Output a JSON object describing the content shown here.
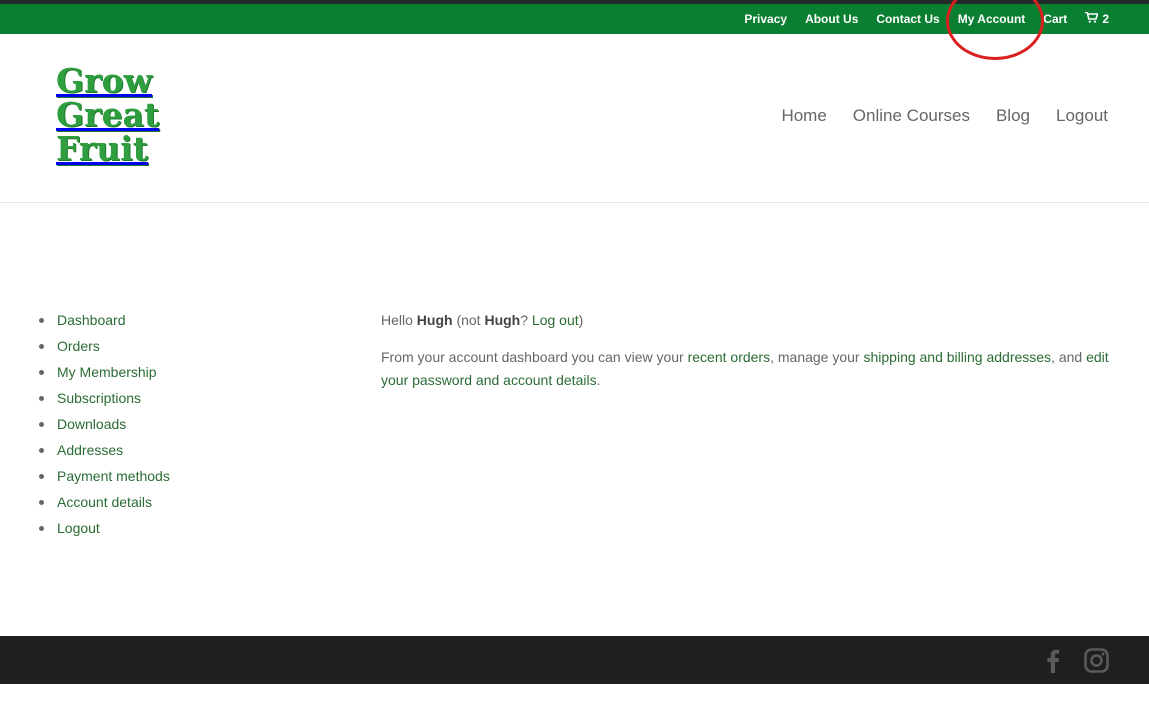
{
  "topbar": {
    "links": [
      "Privacy",
      "About Us",
      "Contact Us",
      "My Account",
      "Cart"
    ],
    "cart_count": "2"
  },
  "logo": {
    "lines": [
      "Grow",
      "Great",
      "Fruit"
    ]
  },
  "main_nav": {
    "items": [
      "Home",
      "Online Courses",
      "Blog",
      "Logout"
    ]
  },
  "account_nav": {
    "items": [
      "Dashboard",
      "Orders",
      "My Membership",
      "Subscriptions",
      "Downloads",
      "Addresses",
      "Payment methods",
      "Account details",
      "Logout"
    ]
  },
  "content": {
    "greeting_prefix": "Hello ",
    "user_name": "Hugh",
    "greeting_mid": " (not ",
    "user_name_2": "Hugh",
    "greeting_q": "? ",
    "logout_link": "Log out",
    "greeting_end": ")",
    "dash_text_1": "From your account dashboard you can view your ",
    "recent_orders_link": "recent orders",
    "dash_text_2": ", manage your ",
    "addresses_link": "shipping and billing addresses",
    "dash_text_3": ", and ",
    "account_link": "edit your password and account details",
    "dash_text_4": "."
  },
  "footer": {
    "icons": [
      "facebook-icon",
      "instagram-icon"
    ]
  },
  "colors": {
    "brand_green": "#0a7f31",
    "link_green": "#2b6c34",
    "footer_bg": "#1f1f1f",
    "annotation_red": "#d9201e"
  }
}
